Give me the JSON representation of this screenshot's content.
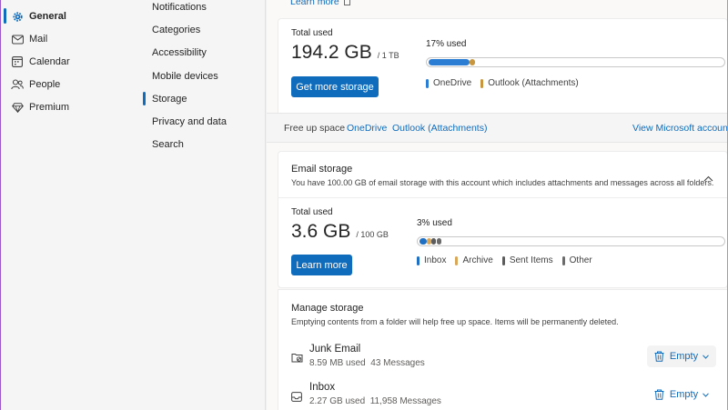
{
  "nav": {
    "items": [
      {
        "label": "General",
        "icon": "gear-icon"
      },
      {
        "label": "Mail",
        "icon": "mail-icon"
      },
      {
        "label": "Calendar",
        "icon": "calendar-icon"
      },
      {
        "label": "People",
        "icon": "people-icon"
      },
      {
        "label": "Premium",
        "icon": "diamond-icon"
      }
    ]
  },
  "subnav": {
    "items": [
      {
        "label": "Notifications"
      },
      {
        "label": "Categories"
      },
      {
        "label": "Accessibility"
      },
      {
        "label": "Mobile devices"
      },
      {
        "label": "Storage"
      },
      {
        "label": "Privacy and data"
      },
      {
        "label": "Search"
      }
    ]
  },
  "top": {
    "learn_more": "Learn more"
  },
  "cloud": {
    "total_label": "Total used",
    "used": "194.2 GB",
    "capacity": "/ 1 TB",
    "percent_label": "17% used",
    "button": "Get more storage",
    "legend": [
      "OneDrive",
      "Outlook (Attachments)"
    ],
    "segments": [
      {
        "name": "OneDrive",
        "fraction": 0.14,
        "color": "#2b7cd3"
      },
      {
        "name": "Outlook (Attachments)",
        "fraction": 0.02,
        "color": "#c8963e"
      }
    ]
  },
  "freeup": {
    "label": "Free up space",
    "links": [
      "OneDrive",
      "Outlook (Attachments)"
    ],
    "view_account": "View Microsoft account"
  },
  "email": {
    "title": "Email storage",
    "description": "You have 100.00 GB of email storage with this account which includes attachments and messages across all folders.",
    "total_label": "Total used",
    "used": "3.6 GB",
    "capacity": "/ 100 GB",
    "percent_label": "3% used",
    "button": "Learn more",
    "legend": [
      {
        "label": "Inbox",
        "color": "#1f6fc2"
      },
      {
        "label": "Archive",
        "color": "#d9a75a"
      },
      {
        "label": "Sent Items",
        "color": "#5c5c5c"
      },
      {
        "label": "Other",
        "color": "#6b6b6b"
      }
    ]
  },
  "manage": {
    "title": "Manage storage",
    "description": "Emptying contents from a folder will help free up space. Items will be permanently deleted.",
    "rows": [
      {
        "name": "Junk Email",
        "size": "8.59 MB used",
        "count": "43 Messages",
        "action": "Empty"
      },
      {
        "name": "Inbox",
        "size": "2.27 GB used",
        "count": "11,958 Messages",
        "action": "Empty"
      }
    ]
  }
}
